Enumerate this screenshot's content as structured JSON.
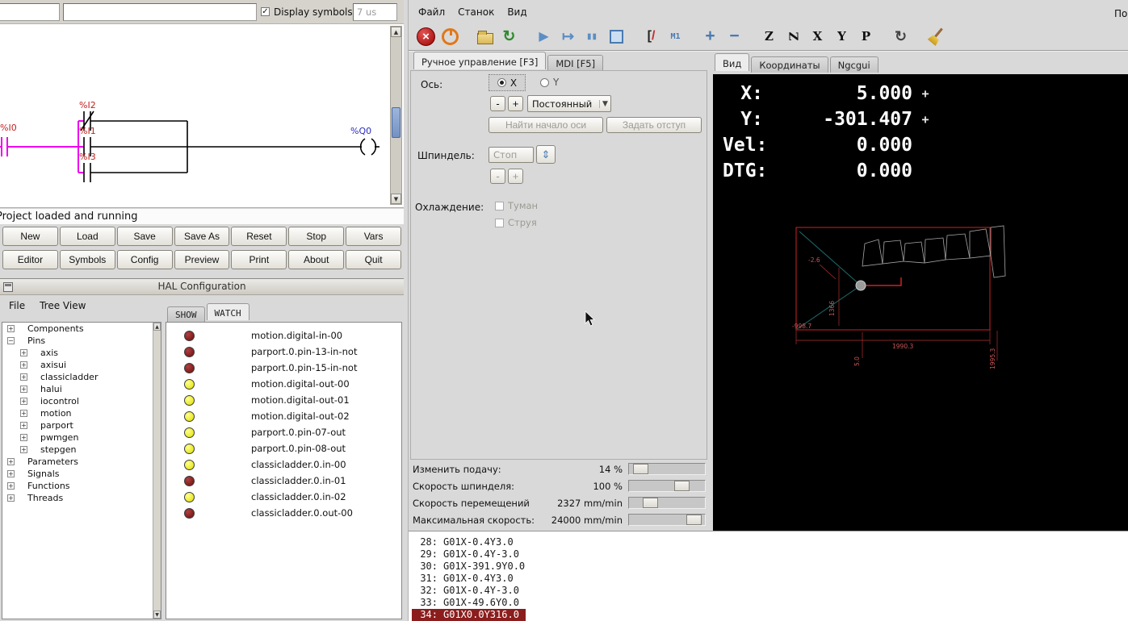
{
  "ladder": {
    "section_entry": "",
    "comment_entry": "",
    "display_symbols_label": "Display symbols",
    "scan_time": "7 us",
    "status": "Project loaded and running",
    "labels": {
      "i0": "%I0",
      "i1": "%I1",
      "i2": "%I2",
      "i3": "%I3",
      "q0": "%Q0"
    },
    "buttons_row1": [
      "New",
      "Load",
      "Save",
      "Save As",
      "Reset",
      "Stop",
      "Vars"
    ],
    "buttons_row2": [
      "Editor",
      "Symbols",
      "Config",
      "Preview",
      "Print",
      "About",
      "Quit"
    ]
  },
  "hal": {
    "title": "HAL Configuration",
    "menus": [
      "File",
      "Tree View"
    ],
    "tabs": [
      {
        "label": "SHOW",
        "cls": ""
      },
      {
        "label": "WATCH",
        "cls": "active"
      }
    ],
    "tree": [
      {
        "label": "Components",
        "lvl": "lvl0",
        "exp": "+"
      },
      {
        "label": "Pins",
        "lvl": "lvl0",
        "exp": "−"
      },
      {
        "label": "axis",
        "lvl": "lvl1",
        "exp": "+"
      },
      {
        "label": "axisui",
        "lvl": "lvl1",
        "exp": "+"
      },
      {
        "label": "classicladder",
        "lvl": "lvl1",
        "exp": "+"
      },
      {
        "label": "halui",
        "lvl": "lvl1",
        "exp": "+"
      },
      {
        "label": "iocontrol",
        "lvl": "lvl1",
        "exp": "+"
      },
      {
        "label": "motion",
        "lvl": "lvl1",
        "exp": "+"
      },
      {
        "label": "parport",
        "lvl": "lvl1",
        "exp": "+"
      },
      {
        "label": "pwmgen",
        "lvl": "lvl1",
        "exp": "+"
      },
      {
        "label": "stepgen",
        "lvl": "lvl1",
        "exp": "+"
      },
      {
        "label": "Parameters",
        "lvl": "lvl0",
        "exp": "+"
      },
      {
        "label": "Signals",
        "lvl": "lvl0",
        "exp": "+"
      },
      {
        "label": "Functions",
        "lvl": "lvl0",
        "exp": "+"
      },
      {
        "label": "Threads",
        "lvl": "lvl0",
        "exp": "+"
      }
    ],
    "watch": [
      {
        "name": "motion.digital-in-00",
        "state": "led-red"
      },
      {
        "name": "parport.0.pin-13-in-not",
        "state": "led-red"
      },
      {
        "name": "parport.0.pin-15-in-not",
        "state": "led-red"
      },
      {
        "name": "motion.digital-out-00",
        "state": "led-yellow"
      },
      {
        "name": "motion.digital-out-01",
        "state": "led-yellow"
      },
      {
        "name": "motion.digital-out-02",
        "state": "led-yellow"
      },
      {
        "name": "parport.0.pin-07-out",
        "state": "led-yellow"
      },
      {
        "name": "parport.0.pin-08-out",
        "state": "led-yellow"
      },
      {
        "name": "classicladder.0.in-00",
        "state": "led-yellow"
      },
      {
        "name": "classicladder.0.in-01",
        "state": "led-red"
      },
      {
        "name": "classicladder.0.in-02",
        "state": "led-yellow"
      },
      {
        "name": "classicladder.0.out-00",
        "state": "led-red"
      }
    ]
  },
  "axis": {
    "menus": [
      "Файл",
      "Станок",
      "Вид"
    ],
    "help_menu": "Помощь",
    "toolbar": [
      {
        "name": "estop-icon",
        "cls": "ic-estop"
      },
      {
        "name": "machine-power-icon",
        "cls": "ic-power"
      },
      {
        "name": "open-file-icon",
        "cls": "ic-open gap"
      },
      {
        "name": "reload-icon",
        "cls": "ic-reload"
      },
      {
        "name": "run-icon",
        "cls": "ic-run gap"
      },
      {
        "name": "step-icon",
        "cls": "ic-step"
      },
      {
        "name": "pause-icon",
        "cls": "ic-pause"
      },
      {
        "name": "stop-icon",
        "cls": "ic-stop"
      },
      {
        "name": "block-delete-icon",
        "cls": "ic-blockdel gap"
      },
      {
        "name": "optional-pause-icon",
        "cls": "ic-optpause"
      },
      {
        "name": "zoom-in-icon",
        "cls": "ic-zoomin gap"
      },
      {
        "name": "zoom-out-icon",
        "cls": "ic-zoomout"
      },
      {
        "name": "view-z-icon",
        "cls": "ic-viewz gap",
        "glyph": "Z"
      },
      {
        "name": "view-z-rotated-icon",
        "cls": "ic-viewz2",
        "glyph": "Z"
      },
      {
        "name": "view-x-icon",
        "cls": "ic-viewx",
        "glyph": "X"
      },
      {
        "name": "view-y-icon",
        "cls": "ic-viewy",
        "glyph": "Y"
      },
      {
        "name": "view-p-icon",
        "cls": "ic-viewp",
        "glyph": "P"
      },
      {
        "name": "rotate-view-icon",
        "cls": "ic-rotate gap"
      },
      {
        "name": "clear-plot-icon",
        "cls": "ic-broom gap"
      }
    ],
    "manual_tabs": [
      {
        "label": "Ручное управление [F3]",
        "cls": "active"
      },
      {
        "label": "MDI [F5]",
        "cls": ""
      }
    ],
    "manual": {
      "axis_label": "Ось:",
      "axis_options": [
        "X",
        "Y"
      ],
      "jog_minus": "-",
      "jog_plus": "+",
      "jog_mode": "Постоянный",
      "home_button": "Найти начало оси",
      "touchoff_button": "Задать отступ",
      "spindle_label": "Шпиндель:",
      "spindle_state": "Стоп",
      "spindle_minus": "-",
      "spindle_plus": "+",
      "coolant_label": "Охлаждение:",
      "mist_label": "Туман",
      "flood_label": "Струя"
    },
    "sliders": [
      {
        "label": "Изменить подачу:",
        "value": "14 %",
        "pos": "5%"
      },
      {
        "label": "Скорость шпинделя:",
        "value": "100 %",
        "pos": "60%"
      },
      {
        "label": "Скорость перемещений",
        "value": "2327 mm/min",
        "pos": "18%"
      },
      {
        "label": "Максимальная скорость:",
        "value": "24000 mm/min",
        "pos": "76%"
      }
    ],
    "view_tabs": [
      {
        "label": "Вид",
        "cls": "active"
      },
      {
        "label": "Координаты",
        "cls": ""
      },
      {
        "label": "Ngcgui",
        "cls": ""
      }
    ],
    "dro": [
      {
        "label": "X:",
        "value": "5.000",
        "icon": "move"
      },
      {
        "label": "Y:",
        "value": "-301.407",
        "icon": "move"
      },
      {
        "label": "Vel:",
        "value": "0.000"
      },
      {
        "label": "DTG:",
        "value": "0.000"
      }
    ],
    "preview": {
      "dim_top": "-2.6",
      "dim_height": "1366",
      "dim_origin": "-998.7",
      "dim_width": "1990.3",
      "dim_small": "5.0",
      "dim_right": "1995.3"
    },
    "gcode": [
      {
        "num": "28:",
        "text": "G01X-0.4Y3.0",
        "cls": ""
      },
      {
        "num": "29:",
        "text": "G01X-0.4Y-3.0",
        "cls": ""
      },
      {
        "num": "30:",
        "text": "G01X-391.9Y0.0",
        "cls": ""
      },
      {
        "num": "31:",
        "text": "G01X-0.4Y3.0",
        "cls": ""
      },
      {
        "num": "32:",
        "text": "G01X-0.4Y-3.0",
        "cls": ""
      },
      {
        "num": "33:",
        "text": "G01X-49.6Y0.0",
        "cls": ""
      },
      {
        "num": "34:",
        "text": "G01X0.0Y316.0",
        "cls": "active"
      }
    ]
  }
}
